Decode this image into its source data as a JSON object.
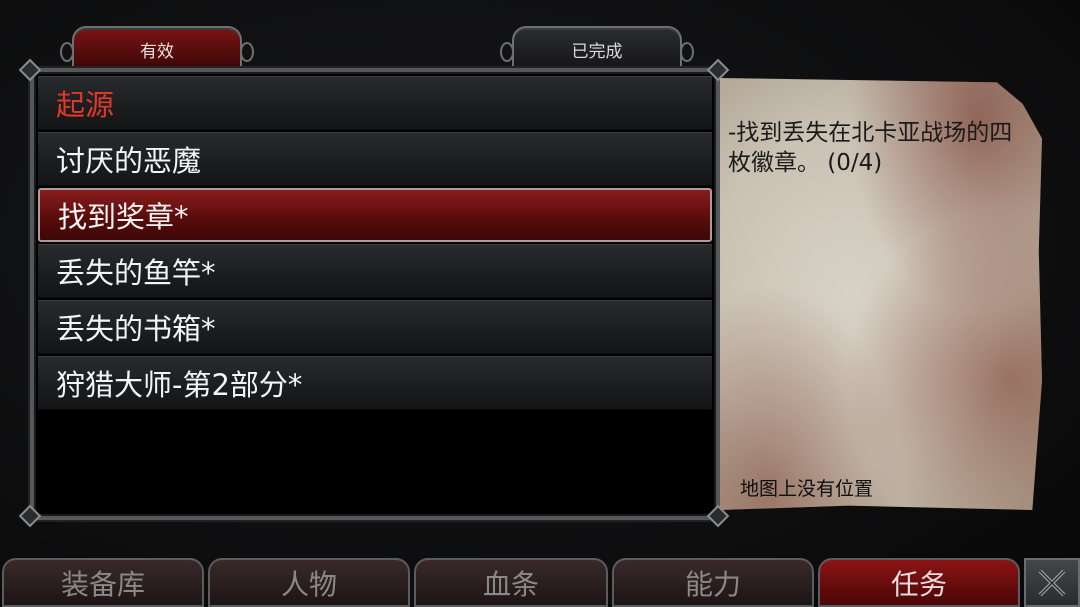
{
  "tabs": {
    "active_label": "有效",
    "completed_label": "已完成"
  },
  "quests": [
    {
      "label": "起源",
      "state": "header"
    },
    {
      "label": "讨厌的恶魔",
      "state": "normal"
    },
    {
      "label": "找到奖章*",
      "state": "selected"
    },
    {
      "label": "丢失的鱼竿*",
      "state": "normal"
    },
    {
      "label": "丢失的书箱*",
      "state": "normal"
    },
    {
      "label": "狩猎大师-第2部分*",
      "state": "normal"
    }
  ],
  "detail": {
    "description": "-找到丢失在北卡亚战场的四枚徽章。 (0/4)",
    "location_note": "地图上没有位置"
  },
  "bottom_nav": {
    "inventory": "装备库",
    "character": "人物",
    "health_bar": "血条",
    "abilities": "能力",
    "quests": "任务"
  },
  "icons": {
    "close": "close-x-icon"
  },
  "colors": {
    "accent_red": "#8c1414",
    "header_text": "#e0392a",
    "parchment": "#cfc7b9"
  }
}
